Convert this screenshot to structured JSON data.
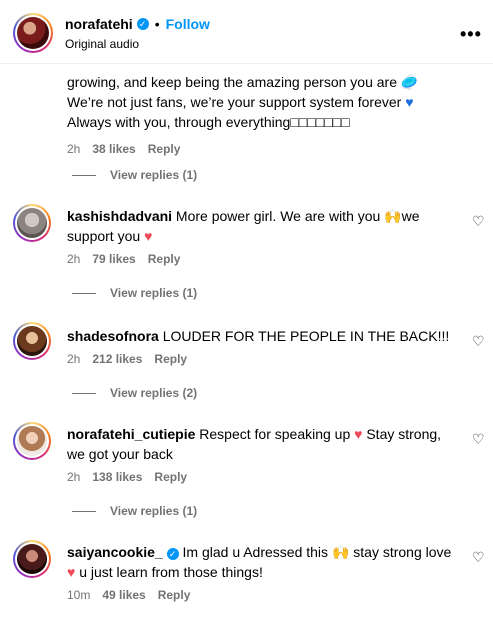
{
  "header": {
    "username": "norafatehi",
    "follow_label": "Follow",
    "separator": "•",
    "subtitle": "Original audio",
    "more_label": "•••"
  },
  "top_comment": {
    "line1": "growing, and keep being the amazing person you are 🥏",
    "line2": "We’re not just fans, we’re your support system forever",
    "line3": "Always with you, through everything",
    "line3_tail": "□□□□□□□",
    "time": "2h",
    "likes": "38 likes",
    "reply": "Reply",
    "view_replies": "View replies (1)"
  },
  "comments": [
    {
      "username": "kashishdadvani",
      "text_a": " More power girl. We are with you ",
      "emoji_a": "🙌",
      "text_b": "we support you ",
      "emoji_b": "♥",
      "time": "2h",
      "likes": "79 likes",
      "reply": "Reply",
      "view_replies": "View replies (1)"
    },
    {
      "username": "shadesofnora",
      "text": " LOUDER FOR THE PEOPLE IN THE BACK!!!",
      "time": "2h",
      "likes": "212 likes",
      "reply": "Reply",
      "view_replies": "View replies (2)"
    },
    {
      "username": "norafatehi_cutiepie",
      "text_a": " Respect for speaking up ",
      "emoji_a": "♥",
      "text_b": "  Stay strong, we got your back",
      "time": "2h",
      "likes": "138 likes",
      "reply": "Reply",
      "view_replies": "View replies (1)"
    },
    {
      "username": "saiyancookie_",
      "text_a": " Im glad u Adressed this ",
      "emoji_a": "🙌",
      "text_b": " stay strong love ",
      "emoji_b": "♥",
      "text_c": " u just learn from those things!",
      "time": "10m",
      "likes": "49 likes",
      "reply": "Reply"
    }
  ],
  "icons": {
    "heart_outline": "♡",
    "verified_check": "✓"
  },
  "colors": {
    "link_blue": "#0095f6",
    "meta_gray": "#737373",
    "heart_red": "#ed4956"
  }
}
